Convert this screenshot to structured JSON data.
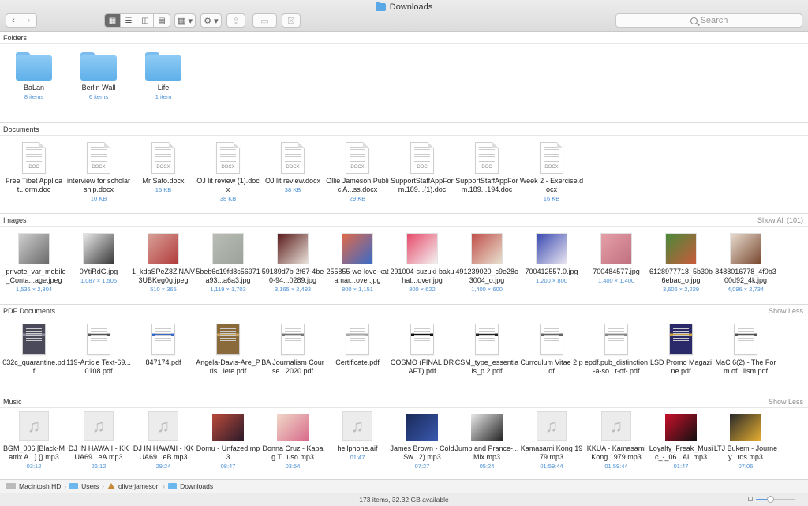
{
  "window": {
    "title": "Downloads",
    "search_placeholder": "Search"
  },
  "toolbar": {
    "back_label": "‹",
    "forward_label": "›",
    "view_icons": [
      "icon-view-icon",
      "list-view-icon",
      "column-view-icon",
      "gallery-view-icon"
    ],
    "arrange_label": "▦ ▾",
    "action_label": "⚙ ▾",
    "share_label": "⇪",
    "tags_label": "▭",
    "trash_label": "☒"
  },
  "sections": {
    "folders": {
      "title": "Folders",
      "more": ""
    },
    "documents": {
      "title": "Documents",
      "more": ""
    },
    "images": {
      "title": "Images",
      "more": "Show All (101)"
    },
    "pdfs": {
      "title": "PDF Documents",
      "more": "Show Less"
    },
    "music": {
      "title": "Music",
      "more": "Show Less"
    }
  },
  "folders": [
    {
      "name": "BaLan",
      "meta": "8 items"
    },
    {
      "name": "Berlin Wall",
      "meta": "6 items"
    },
    {
      "name": "Life",
      "meta": "1 item"
    }
  ],
  "documents": [
    {
      "name": "Free Tibet Applicat...orm.doc",
      "meta": "",
      "ext": "DOC"
    },
    {
      "name": "interview for scholarship.docx",
      "meta": "10 KB",
      "ext": "DOCX"
    },
    {
      "name": "Mr Sato.docx",
      "meta": "15 KB",
      "ext": "DOCX"
    },
    {
      "name": "OJ lit review (1).docx",
      "meta": "38 KB",
      "ext": "DOCX"
    },
    {
      "name": "OJ lit review.docx",
      "meta": "38 KB",
      "ext": "DOCX"
    },
    {
      "name": "Ollie Jameson Public A...ss.docx",
      "meta": "29 KB",
      "ext": "DOCX"
    },
    {
      "name": "SupportStaffAppForm.189...(1).doc",
      "meta": "",
      "ext": "DOC"
    },
    {
      "name": "SupportStaffAppForm.189...194.doc",
      "meta": "",
      "ext": "DOC"
    },
    {
      "name": "Week 2 - Exercise.docx",
      "meta": "16 KB",
      "ext": "DOCX"
    }
  ],
  "images": [
    {
      "name": "_private_var_mobile_Conta...age.jpeg",
      "meta": "1,536 × 2,304",
      "c1": "#cfcfcf",
      "c2": "#6a6a6a"
    },
    {
      "name": "0YtiRdG.jpg",
      "meta": "1,087 × 1,505",
      "c1": "#e9e9e9",
      "c2": "#3a3a3a"
    },
    {
      "name": "1_kdaSPeZ8ZiNAiV3UBKeg0g.jpeg",
      "meta": "510 × 365",
      "c1": "#d8a098",
      "c2": "#b23b3b"
    },
    {
      "name": "5beb6c19fd8c56971a93...a6a3.jpg",
      "meta": "1,119 × 1,703",
      "c1": "#b9bdb5",
      "c2": "#9da39a"
    },
    {
      "name": "59189d7b-2f67-4be0-94...0289.jpg",
      "meta": "3,165 × 2,493",
      "c1": "#5a1a1a",
      "c2": "#e8e0d8"
    },
    {
      "name": "255855-we-love-katamar...over.jpg",
      "meta": "800 × 1,151",
      "c1": "#e06a4a",
      "c2": "#3a6ac8"
    },
    {
      "name": "291004-suzuki-bakuhat...over.jpg",
      "meta": "800 × 622",
      "c1": "#e84a6a",
      "c2": "#f2f2f2"
    },
    {
      "name": "491239020_c9e28c3004_o.jpg",
      "meta": "1,400 × 600",
      "c1": "#c0504a",
      "c2": "#e8e0d0"
    },
    {
      "name": "700412557.0.jpg",
      "meta": "1,200 × 800",
      "c1": "#3a4ab0",
      "c2": "#e8e4f0"
    },
    {
      "name": "700484577.jpg",
      "meta": "1,400 × 1,400",
      "c1": "#e6a0a8",
      "c2": "#c07080"
    },
    {
      "name": "6128977718_5b30b6ebac_o.jpg",
      "meta": "3,606 × 2,229",
      "c1": "#4a8a3a",
      "c2": "#c85a3a"
    },
    {
      "name": "8488016778_4f0b300d92_4k.jpg",
      "meta": "4,096 × 2,734",
      "c1": "#e8dcd0",
      "c2": "#7a4a30"
    }
  ],
  "pdfs": [
    {
      "name": "032c_quarantine.pdf",
      "c1": "#4a4a5a",
      "c2": "#8a8aa0"
    },
    {
      "name": "119-Article Text-69...0108.pdf",
      "c1": "#ffffff",
      "c2": "#555555"
    },
    {
      "name": "847174.pdf",
      "c1": "#ffffff",
      "c2": "#3a6ac8"
    },
    {
      "name": "Angela-Davis-Are_Pris...lete.pdf",
      "c1": "#8a6a3a",
      "c2": "#c8a060"
    },
    {
      "name": "BA Journalism Course...2020.pdf",
      "c1": "#ffffff",
      "c2": "#777777"
    },
    {
      "name": "Certificate.pdf",
      "c1": "#ffffff",
      "c2": "#aaaaaa"
    },
    {
      "name": "COSMO (FINAL DRAFT).pdf",
      "c1": "#ffffff",
      "c2": "#111111"
    },
    {
      "name": "CSM_type_essentials_p.2.pdf",
      "c1": "#ffffff",
      "c2": "#222222"
    },
    {
      "name": "Currculum Vitae 2.pdf",
      "c1": "#ffffff",
      "c2": "#666666"
    },
    {
      "name": "epdf.pub_distinction-a-so...t-of-.pdf",
      "c1": "#ffffff",
      "c2": "#888888"
    },
    {
      "name": "LSD Promo Magazine.pdf",
      "c1": "#2a2a6a",
      "c2": "#c8a040"
    },
    {
      "name": "MaC 6(2) - The Form of...lism.pdf",
      "c1": "#ffffff",
      "c2": "#555555"
    }
  ],
  "music": [
    {
      "name": "BGM_006 [Black-Matrix A...] {}.mp3",
      "meta": "03:12",
      "art": "",
      "c1": "",
      "c2": ""
    },
    {
      "name": "DJ IN HAWAII - KKUA69...eA.mp3",
      "meta": "26:12",
      "art": "",
      "c1": "",
      "c2": ""
    },
    {
      "name": "DJ IN HAWAII - KKUA69...eB.mp3",
      "meta": "29:24",
      "art": "",
      "c1": "",
      "c2": ""
    },
    {
      "name": "Domu - Unfazed.mp3",
      "meta": "08:47",
      "art": "cover",
      "c1": "#b84a3a",
      "c2": "#2a1a2a"
    },
    {
      "name": "Donna Cruz - Kapag T...uso.mp3",
      "meta": "03:54",
      "art": "cover",
      "c1": "#f0d8c8",
      "c2": "#d86a8a"
    },
    {
      "name": "hellphone.aif",
      "meta": "01:47",
      "art": "",
      "c1": "",
      "c2": ""
    },
    {
      "name": "James Brown - Cold Sw...2).mp3",
      "meta": "07:27",
      "art": "cover",
      "c1": "#1a2a5a",
      "c2": "#3a5ab0"
    },
    {
      "name": "Jump and Prance-...Mix.mp3",
      "meta": "05:24",
      "art": "cover",
      "c1": "#e8e8e8",
      "c2": "#222222"
    },
    {
      "name": "Kamasami Kong 1979.mp3",
      "meta": "01:59:44",
      "art": "",
      "c1": "",
      "c2": ""
    },
    {
      "name": "KKUA - Kamasami Kong 1979.mp3",
      "meta": "01:59:44",
      "art": "",
      "c1": "",
      "c2": ""
    },
    {
      "name": "Loyalty_Freak_Music_-_06...AL.mp3",
      "meta": "01:47",
      "art": "cover",
      "c1": "#c8102a",
      "c2": "#111111"
    },
    {
      "name": "LTJ Bukem - Journey...rds.mp3",
      "meta": "07:06",
      "art": "cover",
      "c1": "#2a2a2a",
      "c2": "#e8b030"
    }
  ],
  "pathbar": [
    "Macintosh HD",
    "Users",
    "oliverjameson",
    "Downloads"
  ],
  "status": {
    "text": "173 items, 32.32 GB available",
    "zoom_fraction": 0.35
  }
}
